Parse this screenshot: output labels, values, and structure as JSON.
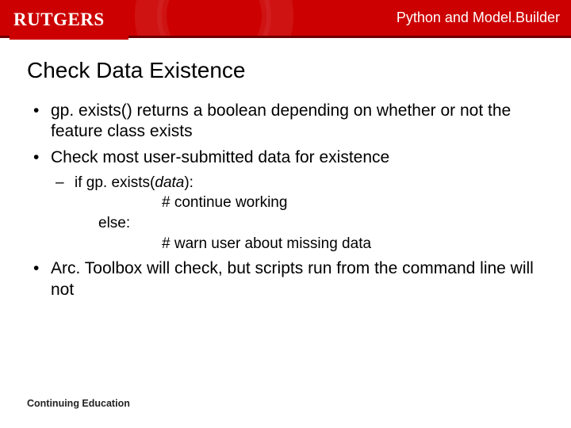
{
  "header": {
    "course_title": "Python and Model.Builder",
    "logo_text": "RUTGERS"
  },
  "title": "Check Data Existence",
  "bullets": [
    "gp. exists() returns a boolean depending on whether or not the feature class exists",
    "Check most user-submitted data for existence"
  ],
  "code": {
    "if_prefix": "if gp. exists(",
    "if_arg": "data",
    "if_suffix": "):",
    "cont": "# continue working",
    "else": "else:",
    "warn": "# warn user about missing data"
  },
  "bullet_after": "Arc. Toolbox will check, but scripts run from the command line will not",
  "footer": "Continuing Education"
}
